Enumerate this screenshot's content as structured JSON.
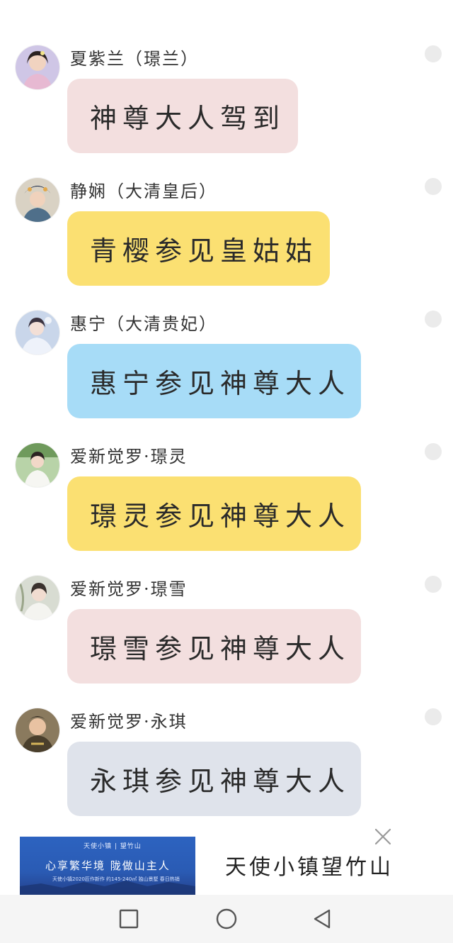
{
  "messages": [
    {
      "name": "夏紫兰（璟兰）",
      "text": "神尊大人驾到",
      "bubble_color": "#f3dfdf",
      "avatar": "avatar-portrait-icon"
    },
    {
      "name": "静娴（大清皇后）",
      "text": "青樱参见皇姑姑",
      "bubble_color": "#fbe072",
      "avatar": "avatar-portrait-icon"
    },
    {
      "name": "惠宁（大清贵妃）",
      "text": "惠宁参见神尊大人",
      "bubble_color": "#a7dcf7",
      "avatar": "avatar-portrait-icon"
    },
    {
      "name": "爱新觉罗·璟灵",
      "text": "璟灵参见神尊大人",
      "bubble_color": "#fbe072",
      "avatar": "avatar-portrait-icon"
    },
    {
      "name": "爱新觉罗·璟雪",
      "text": "璟雪参见神尊大人",
      "bubble_color": "#f3dfdf",
      "avatar": "avatar-portrait-icon"
    },
    {
      "name": "爱新觉罗·永琪",
      "text": "永琪参见神尊大人",
      "bubble_color": "#dfe3eb",
      "avatar": "avatar-portrait-icon"
    }
  ],
  "ad": {
    "banner_brand": "天使小镇 | 望竹山",
    "banner_slogan": "心享繁华境  陇做山主人",
    "banner_sub": "天使小镇2020匠作新作 约145-240㎡ 独山景墅 春日热销",
    "title": "天使小镇望竹山",
    "close_icon": "close-icon"
  },
  "navbar": {
    "recent_icon": "square-recents-icon",
    "home_icon": "circle-home-icon",
    "back_icon": "triangle-back-icon",
    "background": "#f5f5f5"
  }
}
